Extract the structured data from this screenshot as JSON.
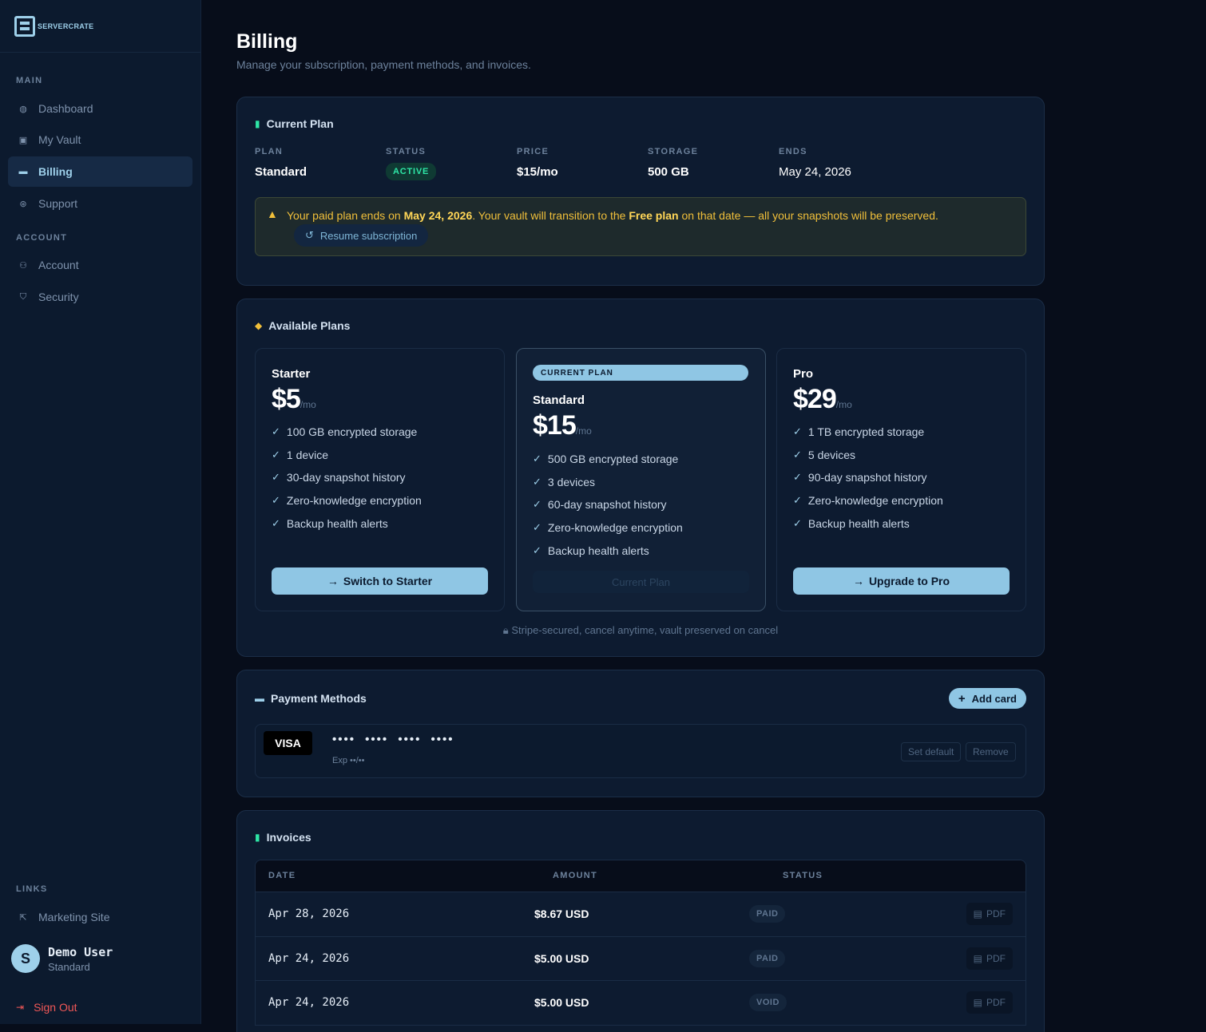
{
  "sidebar": {
    "brand": "SERVERCRATE",
    "sections": {
      "main": "MAIN",
      "account": "ACCOUNT",
      "links": "LINKS"
    },
    "items": [
      {
        "label": "Dashboard",
        "icon": "gauge-icon"
      },
      {
        "label": "My Vault",
        "icon": "vault-icon"
      },
      {
        "label": "Billing",
        "icon": "credit-card-icon",
        "active": true
      },
      {
        "label": "Support",
        "icon": "lifebuoy-icon"
      },
      {
        "label": "Account",
        "icon": "user-gear-icon"
      },
      {
        "label": "Security",
        "icon": "shield-icon"
      },
      {
        "label": "Marketing Site",
        "icon": "external-link-icon"
      }
    ],
    "user": {
      "initial": "S",
      "name": "Demo User",
      "plan": "Standard"
    },
    "signout": "Sign Out"
  },
  "page": {
    "title": "Billing",
    "subtitle": "Manage your subscription, payment methods, and invoices."
  },
  "current_plan": {
    "title": "Current Plan",
    "columns": [
      {
        "label": "PLAN",
        "value": "Standard"
      },
      {
        "label": "STATUS",
        "value": "ACTIVE"
      },
      {
        "label": "PRICE",
        "value": "$15/mo"
      },
      {
        "label": "STORAGE",
        "value": "500 GB"
      },
      {
        "label": "ENDS",
        "value": "May 24, 2026"
      }
    ],
    "notice": {
      "t1": "Your paid plan ends on ",
      "date": "May 24, 2026",
      "t2": ". Your vault will transition to the ",
      "plan": "Free plan",
      "t3": " on that date — all your snapshots will be preserved."
    },
    "resume_label": "Resume subscription"
  },
  "available_plans": {
    "title": "Available Plans",
    "current_tag": "CURRENT PLAN",
    "per": "/mo",
    "plans": [
      {
        "name": "Starter",
        "price": "$5",
        "features": [
          "100 GB encrypted storage",
          "1 device",
          "30-day snapshot history",
          "Zero-knowledge encryption",
          "Backup health alerts"
        ],
        "button": "Switch to Starter"
      },
      {
        "name": "Standard",
        "price": "$15",
        "features": [
          "500 GB encrypted storage",
          "3 devices",
          "60-day snapshot history",
          "Zero-knowledge encryption",
          "Backup health alerts"
        ],
        "button": "Current Plan"
      },
      {
        "name": "Pro",
        "price": "$29",
        "features": [
          "1 TB encrypted storage",
          "5 devices",
          "90-day snapshot history",
          "Zero-knowledge encryption",
          "Backup health alerts"
        ],
        "button": "Upgrade to Pro"
      }
    ],
    "secure_note": "Stripe-secured, cancel anytime, vault preserved on cancel"
  },
  "payment_methods": {
    "title": "Payment Methods",
    "add_label": "Add card",
    "card": {
      "brand": "VISA",
      "number": "•••• •••• •••• ••••",
      "exp": "Exp ••/••"
    },
    "set_default": "Set default",
    "remove": "Remove"
  },
  "invoices": {
    "title": "Invoices",
    "headers": {
      "date": "DATE",
      "amount": "AMOUNT",
      "status": "STATUS"
    },
    "pdf_label": "PDF",
    "rows": [
      {
        "date": "Apr 28, 2026",
        "amount": "$8.67 USD",
        "status": "PAID"
      },
      {
        "date": "Apr 24, 2026",
        "amount": "$5.00 USD",
        "status": "PAID"
      },
      {
        "date": "Apr 24, 2026",
        "amount": "$5.00 USD",
        "status": "VOID"
      }
    ]
  }
}
